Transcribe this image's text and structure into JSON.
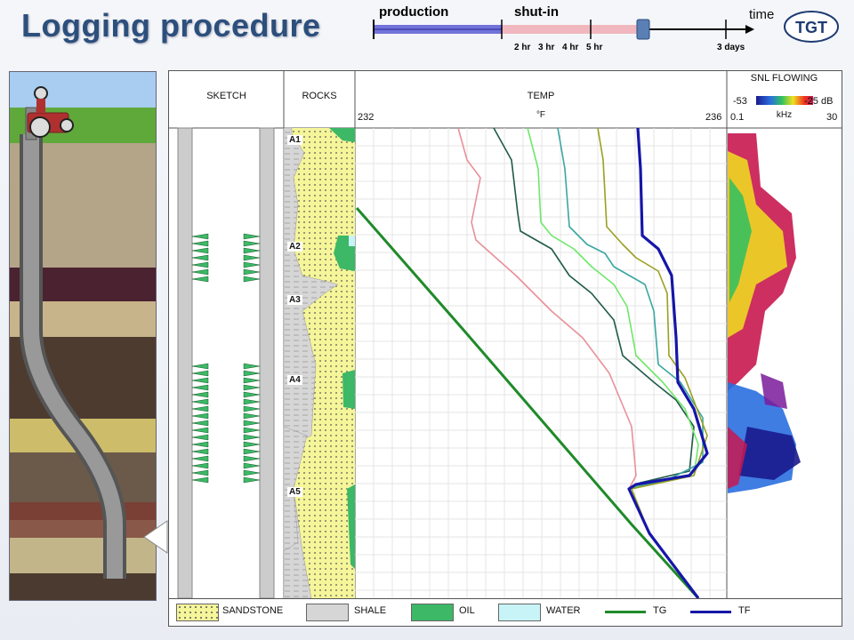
{
  "title": "Logging procedure",
  "timeline": {
    "production_label": "production",
    "shutin_label": "shut-in",
    "time_label": "time",
    "ticks": [
      "2 hr",
      "3 hr",
      "4 hr",
      "5 hr",
      "3 days"
    ]
  },
  "logo_text": "TGT",
  "track": {
    "sketch_header": "SKETCH",
    "rocks_header": "ROCKS",
    "temp_header": "TEMP",
    "temp_min": "232",
    "temp_unit": "°F",
    "temp_max": "236",
    "snl_header": "SNL FLOWING",
    "db_min": "-53",
    "db_max": "-25 dB",
    "khz_min": "0.1",
    "khz_unit": "kHz",
    "khz_max": "30",
    "zones": [
      "A1",
      "A2",
      "A3",
      "A4",
      "A5"
    ]
  },
  "legend": {
    "sandstone": "SANDSTONE",
    "shale": "SHALE",
    "oil": "OIL",
    "water": "WATER",
    "tg": "TG",
    "tf": "TF"
  },
  "colors": {
    "title": "#2c4f7c",
    "production_bar": "#5b5bd6",
    "shutin_bar": "#e8a0a8",
    "sandstone": "#f5f59a",
    "shale": "#d0d0d0",
    "oil": "#3cb867",
    "water": "#c8f4f8",
    "tg": "#1f8a2a",
    "tf": "#1616a8"
  }
}
